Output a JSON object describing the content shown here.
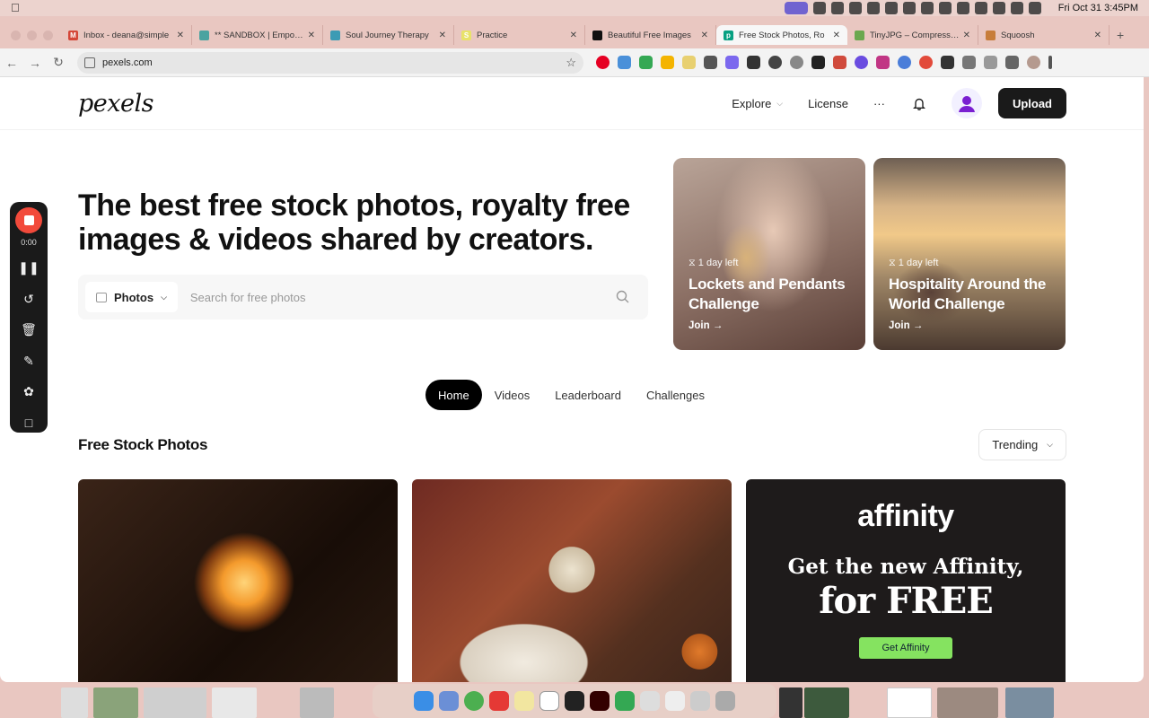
{
  "menubar": {
    "clock": "Fri Oct 31  3:45PM"
  },
  "tabs": [
    {
      "title": "Inbox - deana@simple",
      "fav": "M",
      "favcolor": "#d44638"
    },
    {
      "title": "** SANDBOX | Empowe",
      "fav": "",
      "favcolor": "#4aa3a0"
    },
    {
      "title": "Soul Journey Therapy",
      "fav": "",
      "favcolor": "#3d9bb4"
    },
    {
      "title": "Practice",
      "fav": "S",
      "favcolor": "#e8e26a"
    },
    {
      "title": "Beautiful Free Images",
      "fav": "",
      "favcolor": "#111111"
    },
    {
      "title": "Free Stock Photos, Ro",
      "fav": "p",
      "favcolor": "#07a081",
      "active": true
    },
    {
      "title": "TinyJPG – Compress W",
      "fav": "",
      "favcolor": "#6aa84f"
    },
    {
      "title": "Squoosh",
      "fav": "",
      "favcolor": "#c77d3b"
    }
  ],
  "address": {
    "url": "pexels.com"
  },
  "header": {
    "logo": "pexels",
    "nav": [
      {
        "label": "Explore",
        "chevron": true
      },
      {
        "label": "License"
      },
      {
        "label": "···"
      }
    ],
    "upload": "Upload"
  },
  "hero": {
    "headline": "The best free stock photos, royalty free images & videos shared by creators."
  },
  "search": {
    "type": "Photos",
    "placeholder": "Search for free photos"
  },
  "challenges": [
    {
      "time": "⧖ 1 day left",
      "title": "Lockets and Pendants Challenge",
      "join": "Join →"
    },
    {
      "time": "⧖ 1 day left",
      "title": "Hospitality Around the World Challenge",
      "join": "Join →"
    }
  ],
  "pills": [
    "Home",
    "Videos",
    "Leaderboard",
    "Challenges"
  ],
  "section": {
    "title": "Free Stock Photos",
    "sort": "Trending"
  },
  "ad": {
    "logo": "affinity",
    "line1": "Get the new Affinity,",
    "line2": "for FREE",
    "cta": "Get Affinity"
  },
  "recorder": {
    "time": "0:00"
  }
}
